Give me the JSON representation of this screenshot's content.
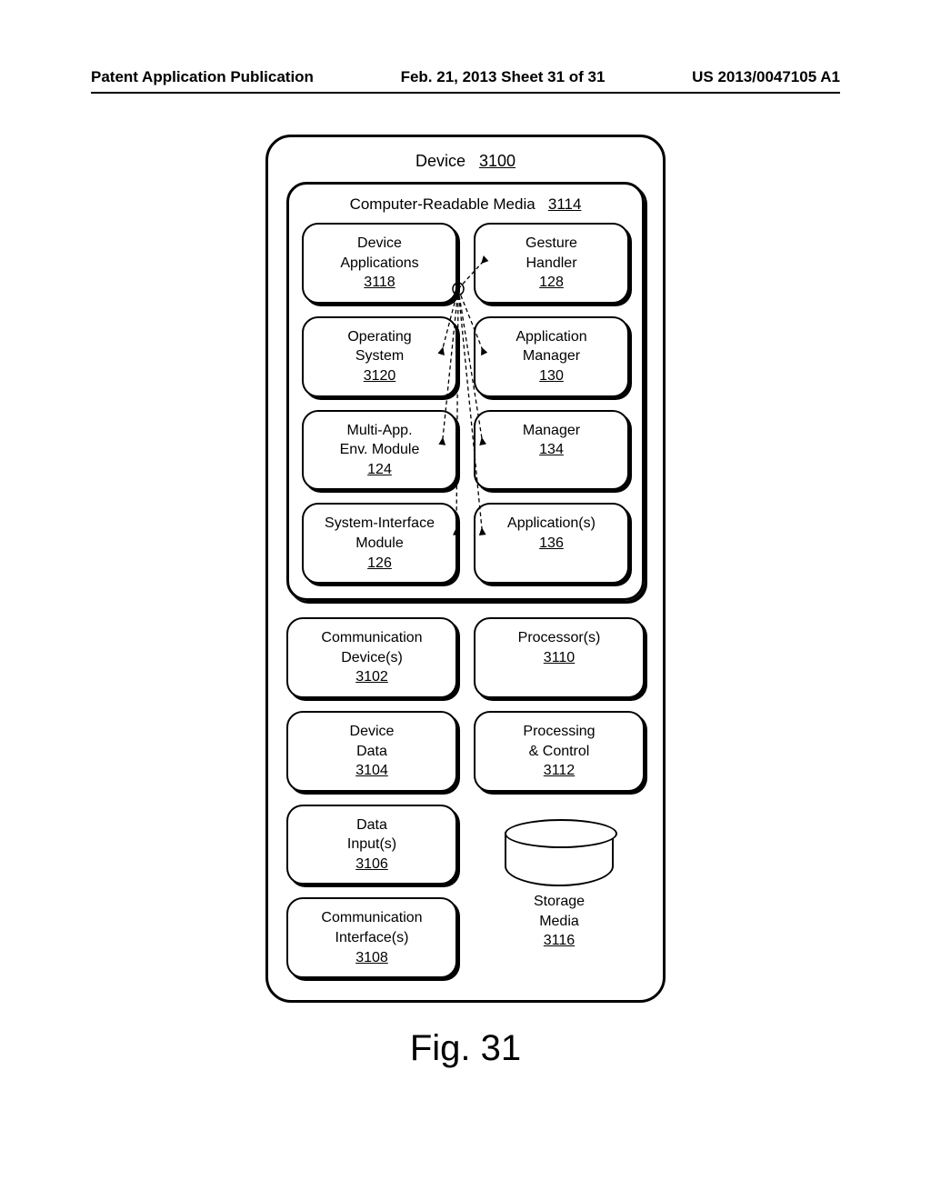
{
  "header": {
    "left": "Patent Application Publication",
    "center": "Feb. 21, 2013  Sheet 31 of 31",
    "right": "US 2013/0047105 A1"
  },
  "device": {
    "label": "Device",
    "num": "3100"
  },
  "crm": {
    "label": "Computer-Readable Media",
    "num": "3114"
  },
  "modules": {
    "device_apps": {
      "line1": "Device",
      "line2": "Applications",
      "num": "3118"
    },
    "gesture_handler": {
      "line1": "Gesture",
      "line2": "Handler",
      "num": "128"
    },
    "os": {
      "line1": "Operating",
      "line2": "System",
      "num": "3120"
    },
    "app_manager": {
      "line1": "Application",
      "line2": "Manager",
      "num": "130"
    },
    "multi_app": {
      "line1": "Multi-App.",
      "line2": "Env. Module",
      "num": "124"
    },
    "manager": {
      "line1": "Manager",
      "num": "134"
    },
    "sys_iface": {
      "line1": "System-Interface",
      "line2": "Module",
      "num": "126"
    },
    "applications": {
      "line1": "Application(s)",
      "num": "136"
    },
    "comm_dev": {
      "line1": "Communication",
      "line2": "Device(s)",
      "num": "3102"
    },
    "processors": {
      "line1": "Processor(s)",
      "num": "3110"
    },
    "device_data": {
      "line1": "Device",
      "line2": "Data",
      "num": "3104"
    },
    "proc_control": {
      "line1": "Processing",
      "line2": "& Control",
      "num": "3112"
    },
    "data_inputs": {
      "line1": "Data",
      "line2": "Input(s)",
      "num": "3106"
    },
    "comm_iface": {
      "line1": "Communication",
      "line2": "Interface(s)",
      "num": "3108"
    },
    "storage": {
      "line1": "Storage",
      "line2": "Media",
      "num": "3116"
    }
  },
  "caption": "Fig. 31"
}
